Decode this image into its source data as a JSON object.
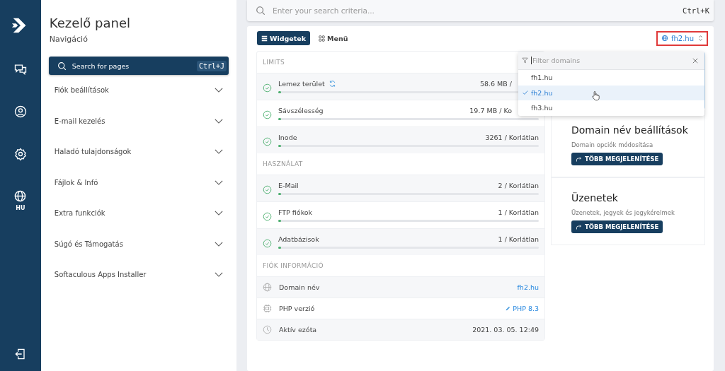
{
  "rail": {
    "language": "HU"
  },
  "nav": {
    "title": "Kezelő panel",
    "subtitle": "Navigáció",
    "search": {
      "placeholder": "Search for pages",
      "shortcut": "Ctrl+J"
    },
    "items": [
      {
        "label": "Fiók beállítások",
        "expanded": false
      },
      {
        "label": "E-mail kezelés",
        "expanded": false
      },
      {
        "label": "Haladó tulajdonságok",
        "expanded": false
      },
      {
        "label": "Fájlok & Infó",
        "expanded": false
      },
      {
        "label": "Extra funkciók",
        "expanded": false
      },
      {
        "label": "Súgó és Támogatás",
        "expanded": false
      },
      {
        "label": "Softaculous Apps Installer",
        "expanded": false
      }
    ]
  },
  "top_search": {
    "placeholder": "Enter your search criteria...",
    "shortcut": "Ctrl+K"
  },
  "view_toggle": [
    {
      "label": "Widgetek",
      "selected": true
    },
    {
      "label": "Menü",
      "selected": false
    }
  ],
  "domain_select": {
    "value": "fh2.hu",
    "highlighted": true
  },
  "domain_menu": {
    "open": true,
    "placeholder": "Filter domains",
    "items": [
      {
        "label": "fh1.hu",
        "selected": false
      },
      {
        "label": "fh2.hu",
        "selected": true
      },
      {
        "label": "fh3.hu",
        "selected": false
      }
    ]
  },
  "sections": [
    {
      "title": "LIMITS",
      "rows": [
        {
          "label": "Lemez terület",
          "value": "58.6 MB /",
          "level": 0.01,
          "ok": true,
          "refresh": true
        },
        {
          "label": "Sávszélesség",
          "value": "19.7 MB / Ko",
          "level": 0.01,
          "ok": true,
          "refresh": false
        },
        {
          "label": "Inode",
          "value": "3261 / Korlátlan",
          "level": 0.01,
          "ok": true,
          "refresh": false
        }
      ]
    },
    {
      "title": "HASZNÁLAT",
      "rows": [
        {
          "label": "E-Mail",
          "value": "2 / Korlátlan",
          "level": 0.01,
          "ok": true,
          "refresh": false
        },
        {
          "label": "FTP fiókok",
          "value": "1 / Korlátlan",
          "level": 0.01,
          "ok": true,
          "refresh": false
        },
        {
          "label": "Adatbázisok",
          "value": "1 / Korlátlan",
          "level": 0.01,
          "ok": true,
          "refresh": false
        }
      ]
    }
  ],
  "info": {
    "title": "FIÓK INFORMÁCIÓ",
    "rows": [
      {
        "label": "Domain név",
        "value": "fh2.hu",
        "kind": "link"
      },
      {
        "label": "PHP verzió",
        "value": "PHP 8.3",
        "kind": "edit"
      },
      {
        "label": "Aktív ezóta",
        "value": "2021. 03. 05. 12:49",
        "kind": "text"
      }
    ]
  },
  "cards": [
    {
      "title": "Domain név beállítások",
      "subtitle": "Domain opciók módosítása",
      "button": "TÖBB MEGJELENÍTÉSE"
    },
    {
      "title": "Üzenetek",
      "subtitle": "Üzenetek, jegyek és jegykérelmek",
      "button": "TÖBB MEGJELENÍTÉSE"
    }
  ]
}
